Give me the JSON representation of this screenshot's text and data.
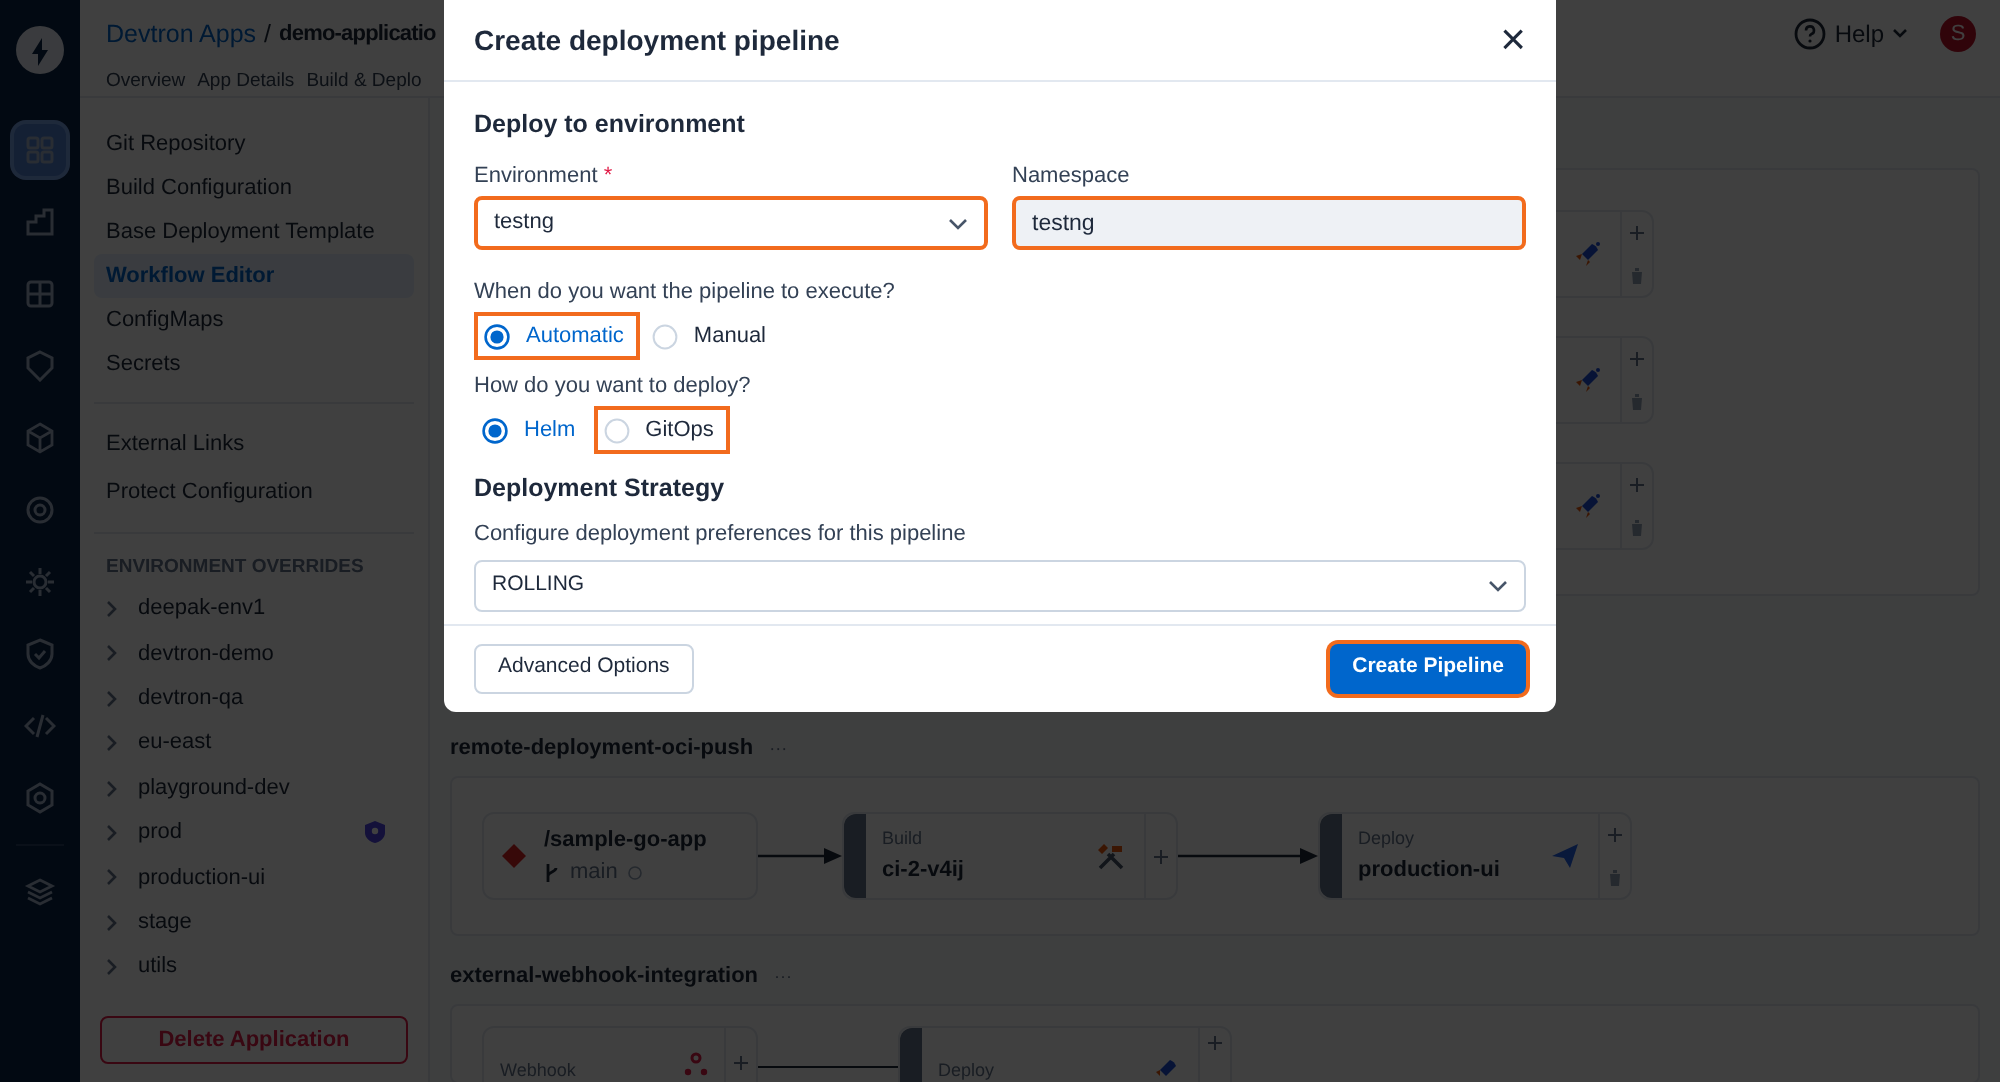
{
  "nav_rail": {
    "items": [
      {
        "kind": "apps",
        "selected": true
      },
      {
        "kind": "charts",
        "selected": false
      },
      {
        "kind": "grid",
        "selected": false
      },
      {
        "kind": "security",
        "selected": false
      },
      {
        "kind": "cube",
        "selected": false
      },
      {
        "kind": "target",
        "selected": false
      },
      {
        "kind": "gear",
        "selected": false
      },
      {
        "kind": "shield",
        "selected": false
      },
      {
        "kind": "code",
        "selected": false
      },
      {
        "kind": "settings",
        "selected": false
      },
      {
        "kind": "stack",
        "selected": false
      }
    ]
  },
  "header": {
    "breadcrumb": "Devtron Apps",
    "separator": "/",
    "app_name": "demo-applicatio",
    "tabs": [
      "Overview",
      "App Details",
      "Build & Deplo"
    ],
    "help": "Help",
    "avatar": "S"
  },
  "sidebar": {
    "items": [
      {
        "label": "Git Repository",
        "selected": false
      },
      {
        "label": "Build Configuration",
        "selected": false
      },
      {
        "label": "Base Deployment Template",
        "selected": false
      },
      {
        "label": "Workflow Editor",
        "selected": true
      },
      {
        "label": "ConfigMaps",
        "selected": false
      },
      {
        "label": "Secrets",
        "selected": false
      }
    ],
    "extra_items": [
      "External Links",
      "Protect Configuration"
    ],
    "section_title": "ENVIRONMENT OVERRIDES",
    "environments": [
      {
        "name": "deepak-env1",
        "protected": false
      },
      {
        "name": "devtron-demo",
        "protected": false
      },
      {
        "name": "devtron-qa",
        "protected": false
      },
      {
        "name": "eu-east",
        "protected": false
      },
      {
        "name": "playground-dev",
        "protected": false
      },
      {
        "name": "prod",
        "protected": true
      },
      {
        "name": "production-ui",
        "protected": false
      },
      {
        "name": "stage",
        "protected": false
      },
      {
        "name": "utils",
        "protected": false
      }
    ],
    "delete_button": "Delete Application"
  },
  "partial_cards": [
    {
      "kind": "deploy"
    },
    {
      "kind": "deploy"
    },
    {
      "kind": "deploy"
    }
  ],
  "workflows": [
    {
      "name": "remote-deployment-oci-push",
      "menu": "···",
      "nodes": [
        {
          "kind": "source",
          "title": "/sample-go-app",
          "branch": "main"
        },
        {
          "kind": "build",
          "label": "Build",
          "title": "ci-2-v4ij"
        },
        {
          "kind": "deploy",
          "label": "Deploy",
          "title": "production-ui"
        }
      ]
    },
    {
      "name": "external-webhook-integration",
      "menu": "···",
      "nodes": [
        {
          "kind": "webhook",
          "label": "Webhook"
        },
        {
          "kind": "deploy_partial",
          "label": "Deploy"
        }
      ]
    }
  ],
  "modal": {
    "title": "Create deployment pipeline",
    "close": "×",
    "section": "Deploy to environment",
    "environment": {
      "label": "Environment",
      "required": "*",
      "value": "testng",
      "highlighted": true
    },
    "namespace": {
      "label": "Namespace",
      "value": "testng",
      "highlighted": true,
      "disabled": true
    },
    "trigger": {
      "question": "When do you want the pipeline to execute?",
      "options": [
        {
          "label": "Automatic",
          "selected": true,
          "highlighted": true
        },
        {
          "label": "Manual",
          "selected": false,
          "highlighted": false
        }
      ]
    },
    "deploy_method": {
      "question": "How do you want to deploy?",
      "options": [
        {
          "label": "Helm",
          "selected": true,
          "highlighted": false
        },
        {
          "label": "GitOps",
          "selected": false,
          "highlighted": true
        }
      ]
    },
    "strategy": {
      "title": "Deployment Strategy",
      "hint": "Configure deployment preferences for this pipeline",
      "value": "ROLLING"
    },
    "buttons": [
      {
        "kind": "secondary",
        "label": "Advanced Options",
        "highlighted": false
      },
      {
        "kind": "primary",
        "label": "Create Pipeline",
        "highlighted": true
      }
    ]
  }
}
